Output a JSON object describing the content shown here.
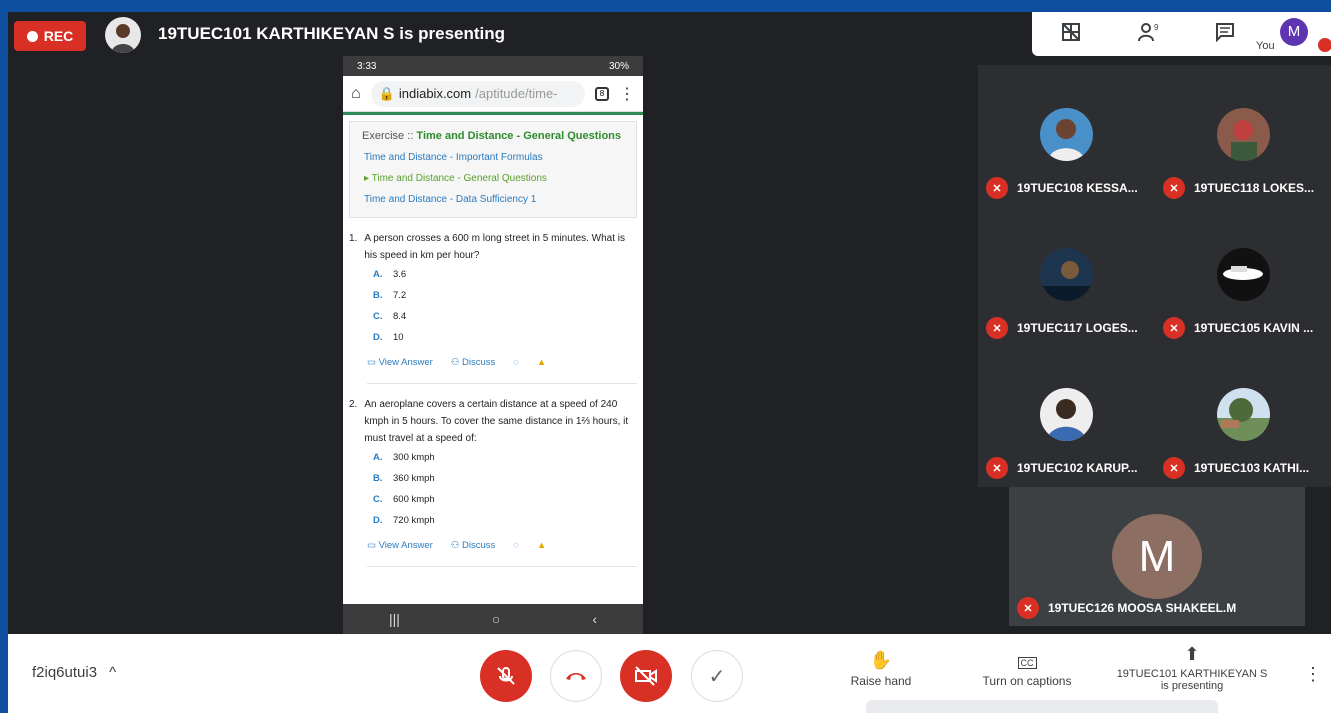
{
  "rec_label": "REC",
  "presenter_title": "19TUEC101 KARTHIKEYAN S is presenting",
  "you_label": "You",
  "me_initial": "M",
  "phone": {
    "time": "3:33",
    "battery": "30%",
    "url_domain": "indiabix.com",
    "url_path": "/aptitude/time-",
    "tab_count": "8",
    "exercise_prefix": "Exercise ::",
    "exercise_title": "Time and Distance - General Questions",
    "links": [
      "Time and Distance - Important Formulas",
      "Time and Distance - General Questions",
      "Time and Distance - Data Sufficiency 1"
    ],
    "questions": [
      {
        "num": "1.",
        "text": "A person crosses a 600 m long street in 5 minutes. What is his speed in km per hour?",
        "options": [
          {
            "l": "A.",
            "v": "3.6"
          },
          {
            "l": "B.",
            "v": "7.2"
          },
          {
            "l": "C.",
            "v": "8.4"
          },
          {
            "l": "D.",
            "v": "10"
          }
        ]
      },
      {
        "num": "2.",
        "text": "An aeroplane covers a certain distance at a speed of 240 kmph in 5 hours. To cover the same distance in 1⅔ hours, it must travel at a speed of:",
        "options": [
          {
            "l": "A.",
            "v": "300 kmph"
          },
          {
            "l": "B.",
            "v": "360 kmph"
          },
          {
            "l": "C.",
            "v": "600 kmph"
          },
          {
            "l": "D.",
            "v": "720 kmph"
          }
        ]
      }
    ],
    "view_answer": "View Answer",
    "discuss": "Discuss"
  },
  "participants": [
    {
      "name": "19TUEC108 KESSA...",
      "avatar_color": "#4a90c8"
    },
    {
      "name": "19TUEC118 LOKES...",
      "avatar_color": "#8a5a4a"
    },
    {
      "name": "19TUEC117 LOGES...",
      "avatar_color": "#1e3550"
    },
    {
      "name": "19TUEC105 KAVIN ...",
      "avatar_color": "#111111"
    },
    {
      "name": "19TUEC102 KARUP...",
      "avatar_color": "#3a6ab0"
    },
    {
      "name": "19TUEC103 KATHI...",
      "avatar_color": "#6f8f5a"
    }
  ],
  "self_initial": "M",
  "self_name": "19TUEC126 MOOSA SHAKEEL.M",
  "meeting_code": "f2iq6utui3",
  "actions": {
    "raise_hand": "Raise hand",
    "captions": "Turn on captions",
    "presenting_line1": "19TUEC101 KARTHIKEYAN S",
    "presenting_line2": "is presenting"
  },
  "colors": {
    "accent_red": "#d93025",
    "tile_bg": "#3c4043",
    "page_bg": "#202124"
  }
}
